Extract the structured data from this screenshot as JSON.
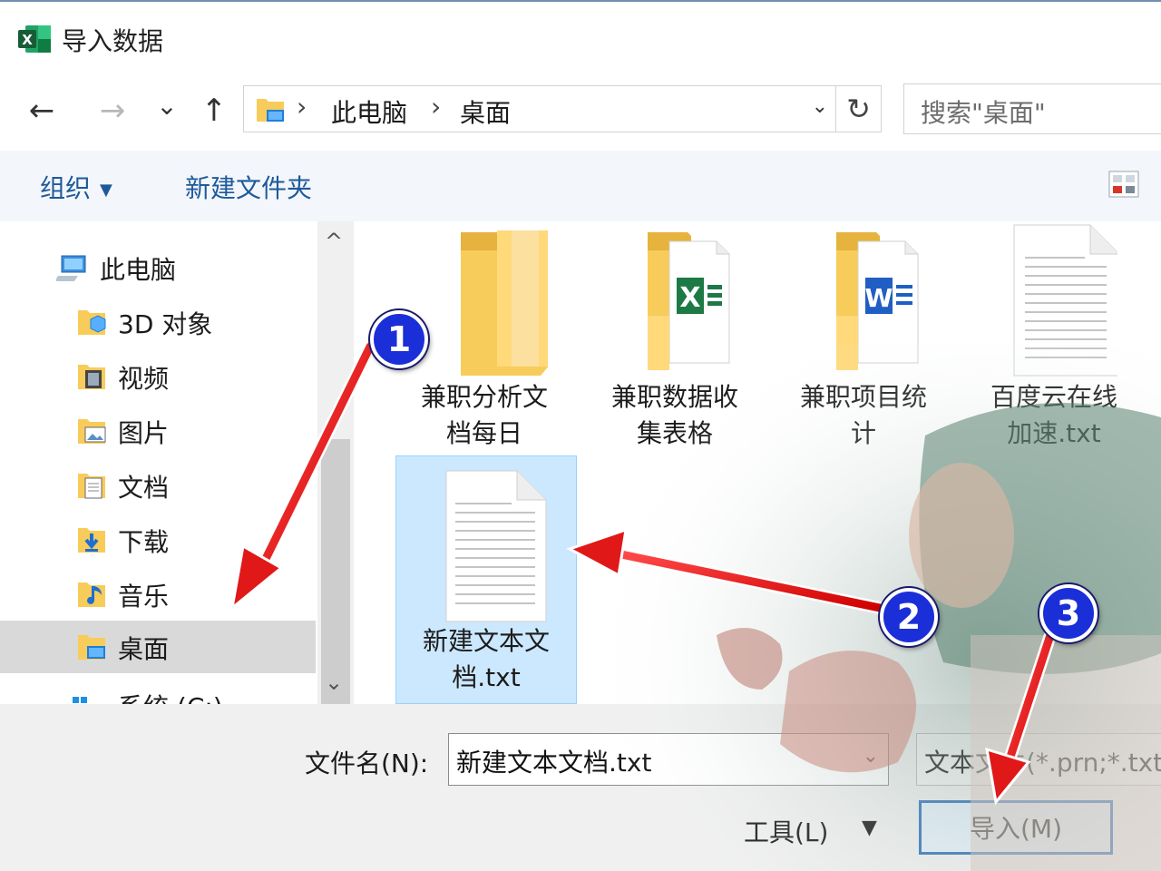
{
  "window": {
    "title": "导入数据"
  },
  "nav": {
    "back": "←",
    "forward": "→",
    "recent": "⌄",
    "up": "↑",
    "refresh": "↻",
    "address": [
      "此电脑",
      "桌面"
    ],
    "address_sep": "›",
    "address_dropdown": "⌄",
    "search_placeholder": "搜索\"桌面\""
  },
  "toolbar": {
    "organize": "组织",
    "organize_caret": "▼",
    "new_folder": "新建文件夹"
  },
  "sidebar": {
    "items": [
      {
        "label": "此电脑",
        "icon": "computer-icon"
      },
      {
        "label": "3D 对象",
        "icon": "3d-objects-icon"
      },
      {
        "label": "视频",
        "icon": "videos-icon"
      },
      {
        "label": "图片",
        "icon": "pictures-icon"
      },
      {
        "label": "文档",
        "icon": "documents-icon"
      },
      {
        "label": "下载",
        "icon": "downloads-icon"
      },
      {
        "label": "音乐",
        "icon": "music-icon"
      },
      {
        "label": "桌面",
        "icon": "desktop-icon",
        "selected": true
      },
      {
        "label": "系统 (C:)",
        "icon": "windows-drive-icon"
      }
    ],
    "scroll_up": "^",
    "scroll_down": "⌄"
  },
  "files": [
    {
      "line1": "兼职分析文",
      "line2": "档每日",
      "icon": "folder-icon"
    },
    {
      "line1": "兼职数据收",
      "line2": "集表格",
      "icon": "folder-excel-icon"
    },
    {
      "line1": "兼职项目统",
      "line2": "计",
      "icon": "folder-word-icon"
    },
    {
      "line1": "百度云在线",
      "line2": "加速.txt",
      "icon": "text-file-icon"
    },
    {
      "line1": "新建文本文",
      "line2": "档.txt",
      "icon": "text-file-icon",
      "selected": true
    }
  ],
  "footer": {
    "filename_label": "文件名(N):",
    "filename_value": "新建文本文档.txt",
    "filename_dropdown": "⌄",
    "filetype": "文本文件(*.prn;*.txt",
    "tools": "工具(L)",
    "tools_caret": "▼",
    "import": "导入(M)"
  },
  "annotations": [
    "1",
    "2",
    "3"
  ],
  "colors": {
    "accent": "#2d6fb7",
    "selection": "#cce8ff",
    "arrow": "#e01818",
    "badge": "#1a2fd8",
    "folder": "#f8cc5a"
  }
}
